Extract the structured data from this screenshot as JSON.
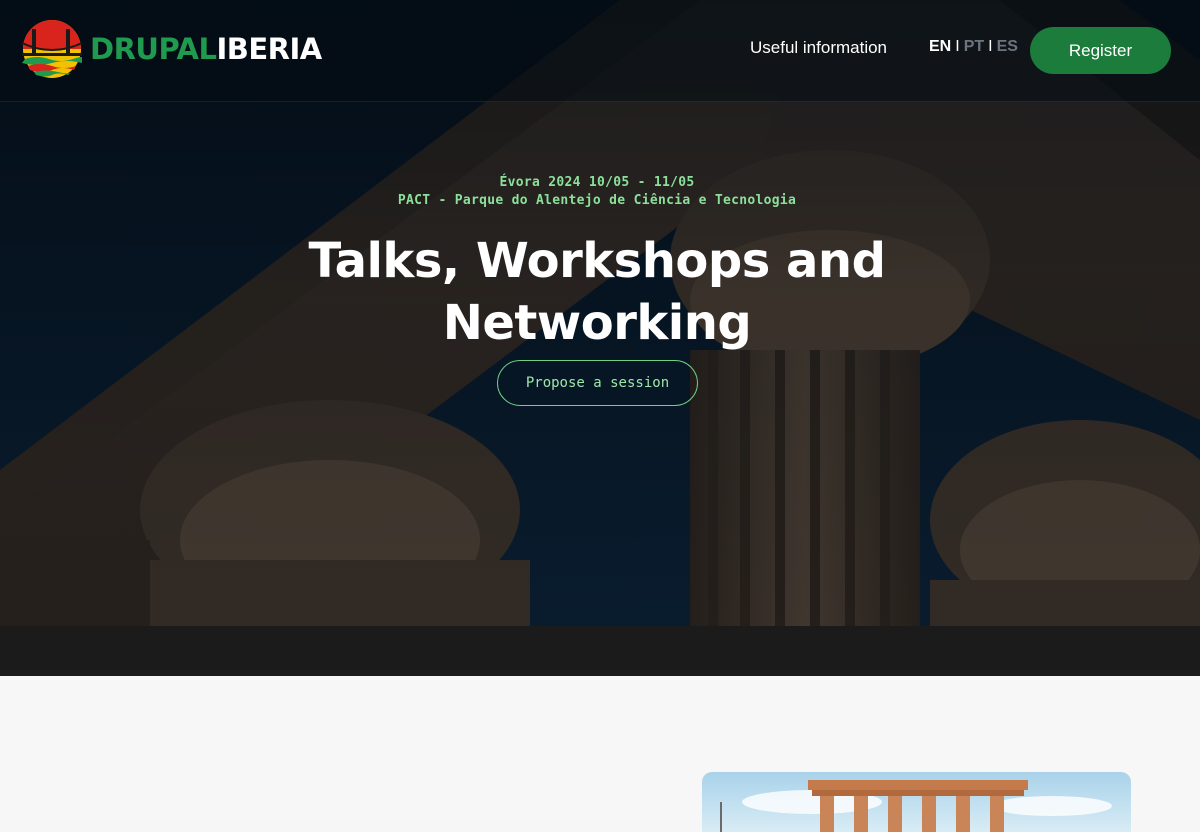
{
  "header": {
    "logo": {
      "word1": "DRUPAL",
      "word2": "IBERIA",
      "icon": "drupal-iberia-bridge-logo"
    },
    "nav": {
      "useful_info": "Useful information"
    },
    "languages": {
      "en": "EN",
      "pt": "PT",
      "es": "ES",
      "separator": "I",
      "active": "EN"
    },
    "register_label": "Register"
  },
  "hero": {
    "date_line": "Évora 2024 10/05 - 11/05",
    "venue_line": "PACT - Parque do Alentejo de Ciência e Tecnologia",
    "title_line1": "Talks, Workshops and",
    "title_line2": "Networking",
    "cta_label": "Propose a session"
  },
  "colors": {
    "accent_green": "#1b7c3b",
    "meta_green": "#8ce09a",
    "header_bg": "#06121d",
    "dark_band": "#1b1b1b",
    "page_bg": "#f7f7f7"
  }
}
